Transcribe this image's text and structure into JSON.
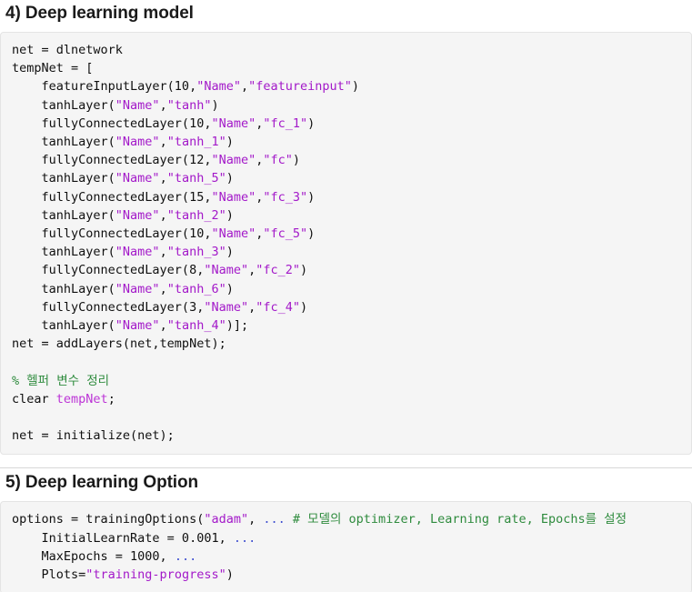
{
  "document": {
    "type": "matlab-live-script",
    "colors": {
      "string": "#a319c9",
      "comment": "#2e8b3d",
      "variable": "#bc34d6",
      "ellipsis": "#3f4fd0",
      "code_background": "#f5f5f5",
      "code_border": "#e4e4e4",
      "text": "#101010",
      "heading": "#1a1a1a"
    }
  },
  "sections": [
    {
      "heading": "4) Deep learning model",
      "code_lines": [
        [
          {
            "t": "net = dlnetwork",
            "c": "plain"
          }
        ],
        [
          {
            "t": "tempNet = [",
            "c": "plain"
          }
        ],
        [
          {
            "t": "    featureInputLayer(10,",
            "c": "plain"
          },
          {
            "t": "\"Name\"",
            "c": "str"
          },
          {
            "t": ",",
            "c": "plain"
          },
          {
            "t": "\"featureinput\"",
            "c": "str"
          },
          {
            "t": ")",
            "c": "plain"
          }
        ],
        [
          {
            "t": "    tanhLayer(",
            "c": "plain"
          },
          {
            "t": "\"Name\"",
            "c": "str"
          },
          {
            "t": ",",
            "c": "plain"
          },
          {
            "t": "\"tanh\"",
            "c": "str"
          },
          {
            "t": ")",
            "c": "plain"
          }
        ],
        [
          {
            "t": "    fullyConnectedLayer(10,",
            "c": "plain"
          },
          {
            "t": "\"Name\"",
            "c": "str"
          },
          {
            "t": ",",
            "c": "plain"
          },
          {
            "t": "\"fc_1\"",
            "c": "str"
          },
          {
            "t": ")",
            "c": "plain"
          }
        ],
        [
          {
            "t": "    tanhLayer(",
            "c": "plain"
          },
          {
            "t": "\"Name\"",
            "c": "str"
          },
          {
            "t": ",",
            "c": "plain"
          },
          {
            "t": "\"tanh_1\"",
            "c": "str"
          },
          {
            "t": ")",
            "c": "plain"
          }
        ],
        [
          {
            "t": "    fullyConnectedLayer(12,",
            "c": "plain"
          },
          {
            "t": "\"Name\"",
            "c": "str"
          },
          {
            "t": ",",
            "c": "plain"
          },
          {
            "t": "\"fc\"",
            "c": "str"
          },
          {
            "t": ")",
            "c": "plain"
          }
        ],
        [
          {
            "t": "    tanhLayer(",
            "c": "plain"
          },
          {
            "t": "\"Name\"",
            "c": "str"
          },
          {
            "t": ",",
            "c": "plain"
          },
          {
            "t": "\"tanh_5\"",
            "c": "str"
          },
          {
            "t": ")",
            "c": "plain"
          }
        ],
        [
          {
            "t": "    fullyConnectedLayer(15,",
            "c": "plain"
          },
          {
            "t": "\"Name\"",
            "c": "str"
          },
          {
            "t": ",",
            "c": "plain"
          },
          {
            "t": "\"fc_3\"",
            "c": "str"
          },
          {
            "t": ")",
            "c": "plain"
          }
        ],
        [
          {
            "t": "    tanhLayer(",
            "c": "plain"
          },
          {
            "t": "\"Name\"",
            "c": "str"
          },
          {
            "t": ",",
            "c": "plain"
          },
          {
            "t": "\"tanh_2\"",
            "c": "str"
          },
          {
            "t": ")",
            "c": "plain"
          }
        ],
        [
          {
            "t": "    fullyConnectedLayer(10,",
            "c": "plain"
          },
          {
            "t": "\"Name\"",
            "c": "str"
          },
          {
            "t": ",",
            "c": "plain"
          },
          {
            "t": "\"fc_5\"",
            "c": "str"
          },
          {
            "t": ")",
            "c": "plain"
          }
        ],
        [
          {
            "t": "    tanhLayer(",
            "c": "plain"
          },
          {
            "t": "\"Name\"",
            "c": "str"
          },
          {
            "t": ",",
            "c": "plain"
          },
          {
            "t": "\"tanh_3\"",
            "c": "str"
          },
          {
            "t": ")",
            "c": "plain"
          }
        ],
        [
          {
            "t": "    fullyConnectedLayer(8,",
            "c": "plain"
          },
          {
            "t": "\"Name\"",
            "c": "str"
          },
          {
            "t": ",",
            "c": "plain"
          },
          {
            "t": "\"fc_2\"",
            "c": "str"
          },
          {
            "t": ")",
            "c": "plain"
          }
        ],
        [
          {
            "t": "    tanhLayer(",
            "c": "plain"
          },
          {
            "t": "\"Name\"",
            "c": "str"
          },
          {
            "t": ",",
            "c": "plain"
          },
          {
            "t": "\"tanh_6\"",
            "c": "str"
          },
          {
            "t": ")",
            "c": "plain"
          }
        ],
        [
          {
            "t": "    fullyConnectedLayer(3,",
            "c": "plain"
          },
          {
            "t": "\"Name\"",
            "c": "str"
          },
          {
            "t": ",",
            "c": "plain"
          },
          {
            "t": "\"fc_4\"",
            "c": "str"
          },
          {
            "t": ")",
            "c": "plain"
          }
        ],
        [
          {
            "t": "    tanhLayer(",
            "c": "plain"
          },
          {
            "t": "\"Name\"",
            "c": "str"
          },
          {
            "t": ",",
            "c": "plain"
          },
          {
            "t": "\"tanh_4\"",
            "c": "str"
          },
          {
            "t": ")];",
            "c": "plain"
          }
        ],
        [
          {
            "t": "net = addLayers(net,tempNet);",
            "c": "plain"
          }
        ],
        [],
        [
          {
            "t": "% 헬퍼 변수 정리",
            "c": "com"
          }
        ],
        [
          {
            "t": "clear ",
            "c": "plain"
          },
          {
            "t": "tempNet",
            "c": "var"
          },
          {
            "t": ";",
            "c": "plain"
          }
        ],
        [],
        [
          {
            "t": "net = initialize(net);",
            "c": "plain"
          }
        ]
      ],
      "has_divider": true
    },
    {
      "heading": "5) Deep learning Option",
      "code_lines": [
        [
          {
            "t": "options = trainingOptions(",
            "c": "plain"
          },
          {
            "t": "\"adam\"",
            "c": "str"
          },
          {
            "t": ", ",
            "c": "plain"
          },
          {
            "t": "...",
            "c": "ell"
          },
          {
            "t": " ",
            "c": "plain"
          },
          {
            "t": "# 모델의 optimizer, Learning rate, Epochs를 설정",
            "c": "com"
          }
        ],
        [
          {
            "t": "    InitialLearnRate = 0.001, ",
            "c": "plain"
          },
          {
            "t": "...",
            "c": "ell"
          }
        ],
        [
          {
            "t": "    MaxEpochs = 1000, ",
            "c": "plain"
          },
          {
            "t": "...",
            "c": "ell"
          }
        ],
        [
          {
            "t": "    Plots=",
            "c": "plain"
          },
          {
            "t": "\"training-progress\"",
            "c": "str"
          },
          {
            "t": ")",
            "c": "plain"
          }
        ]
      ],
      "has_divider": false
    }
  ]
}
